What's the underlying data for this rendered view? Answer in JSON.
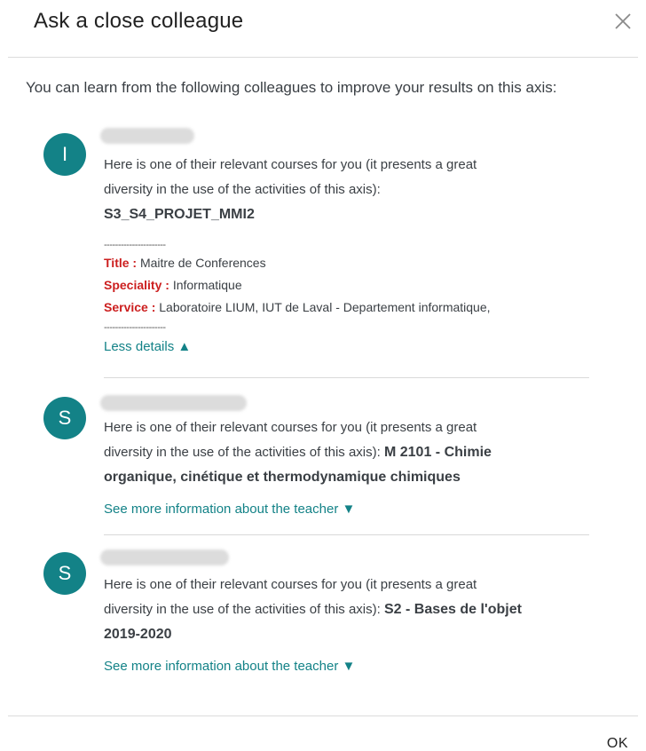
{
  "dialog": {
    "title": "Ask a close colleague",
    "intro": "You can learn from the following colleagues to improve your results on this axis:",
    "ok_label": "OK"
  },
  "colleagues": [
    {
      "initial": "I",
      "text": "Here is one of their relevant courses for you (it presents a great diversity in the use of the activities of this axis):",
      "course": "S3_S4_PROJET_MMI2",
      "details": {
        "separator": "----------------------",
        "title_label": "Title :",
        "title_value": "Maitre de Conferences",
        "speciality_label": "Speciality :",
        "speciality_value": "Informatique",
        "service_label": "Service :",
        "service_value": "Laboratoire LIUM, IUT de Laval - Departement informatique,"
      },
      "toggle": "Less details ▲"
    },
    {
      "initial": "S",
      "text_line1": "Here is one of their relevant courses for you (it presents a great",
      "text_line2": "diversity in the use of the activities of this axis):",
      "course_part1": "M 2101 - Chimie",
      "course_part2": "organique, cinétique et thermodynamique chimiques",
      "toggle": "See more information about the teacher ▼"
    },
    {
      "initial": "S",
      "text_line1": "Here is one of their relevant courses for you (it presents a great",
      "text_line2": "diversity in the use of the activities of this axis):",
      "course_part1": "S2 - Bases de l'objet",
      "course_part2": "2019-2020",
      "toggle": "See more information about the teacher ▼"
    }
  ]
}
